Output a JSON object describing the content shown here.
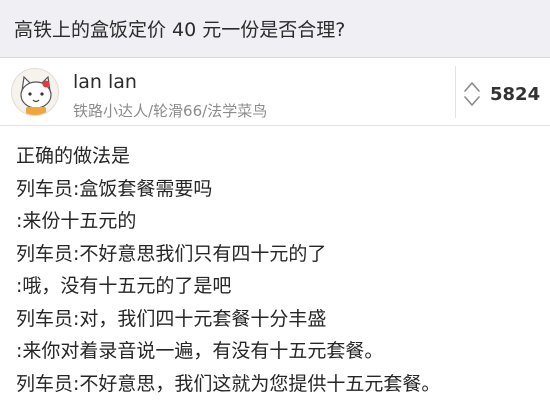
{
  "question": {
    "title": "高铁上的盒饭定价 40 元一份是否合理?"
  },
  "author": {
    "name": "lan lan",
    "bio": "铁路小达人/轮滑66/法学菜鸟",
    "avatar_icon": "cartoon-cat-avatar"
  },
  "votes": {
    "count": "5824",
    "icon": "vote-up-down-icon"
  },
  "answer": {
    "lines": [
      "正确的做法是",
      "列车员:盒饭套餐需要吗",
      ":来份十五元的",
      "列车员:不好意思我们只有四十元的了",
      ":哦，没有十五元的了是吧",
      "列车员:对，我们四十元套餐十分丰盛",
      ":来你对着录音说一遍，有没有十五元套餐。",
      "列车员:不好意思，我们这就为您提供十五元套餐。"
    ]
  }
}
